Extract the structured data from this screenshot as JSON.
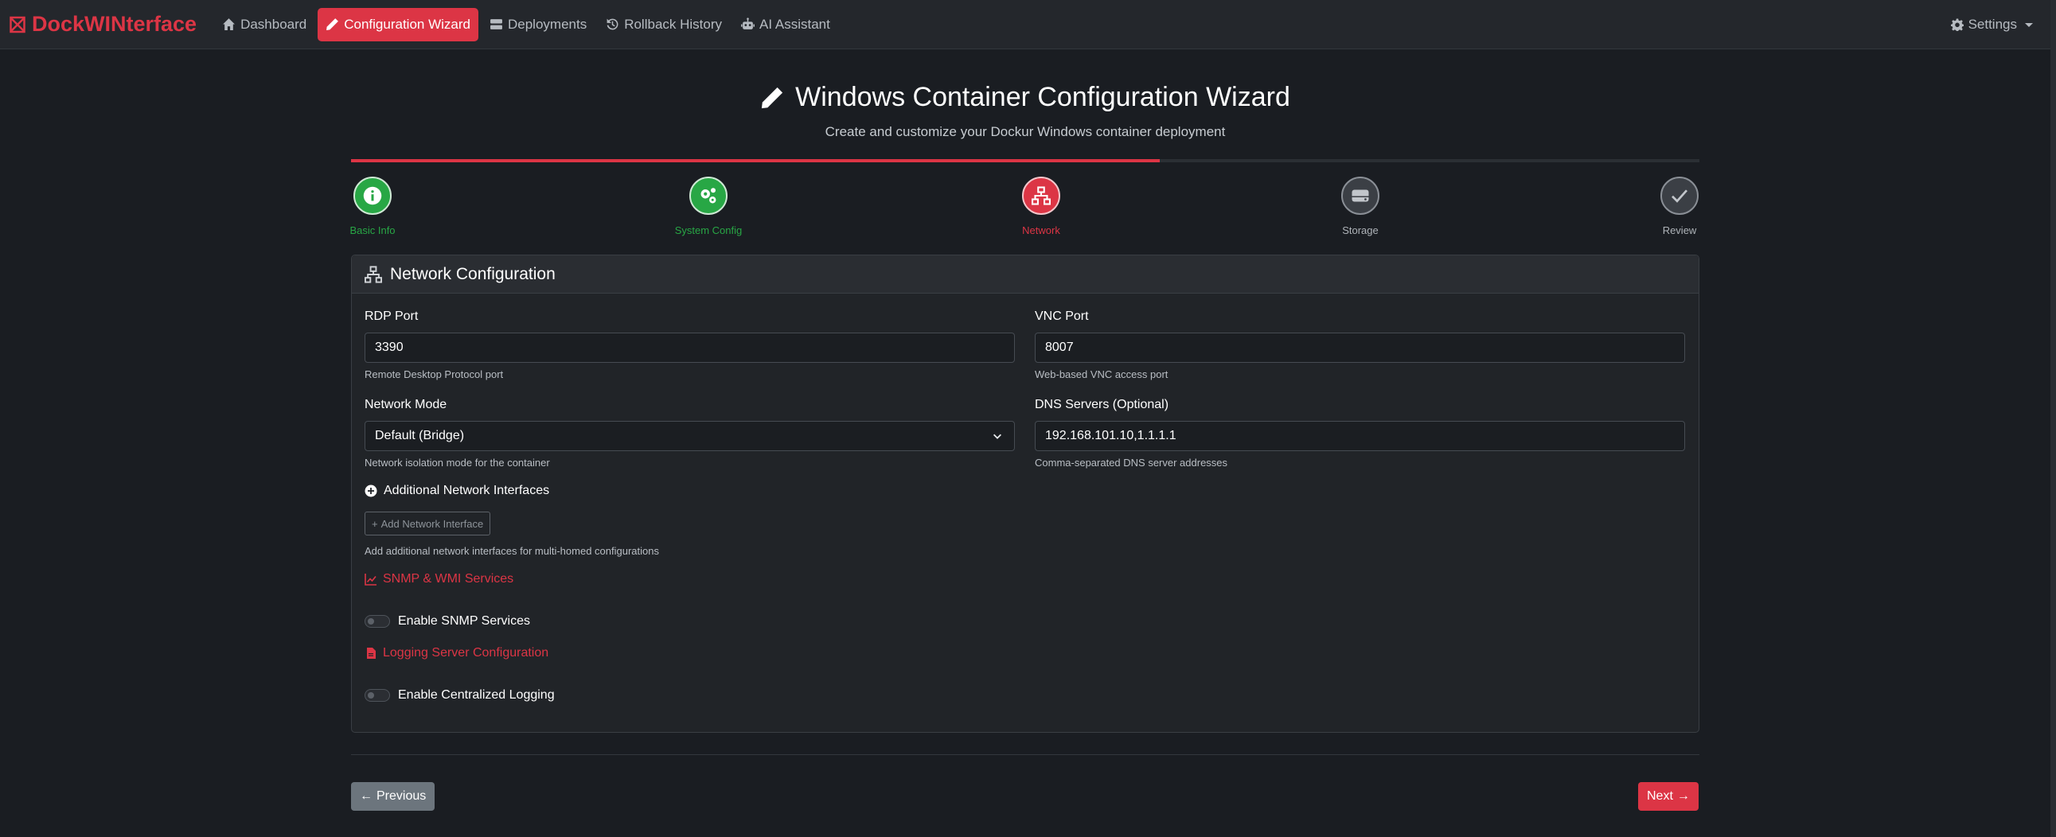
{
  "nav": {
    "brand": "DockWINterface",
    "links": [
      {
        "label": "Dashboard",
        "icon": "home-icon",
        "active": false
      },
      {
        "label": "Configuration Wizard",
        "icon": "pencil-icon",
        "active": true
      },
      {
        "label": "Deployments",
        "icon": "server-icon",
        "active": false
      },
      {
        "label": "Rollback History",
        "icon": "history-icon",
        "active": false
      },
      {
        "label": "AI Assistant",
        "icon": "robot-icon",
        "active": false
      }
    ],
    "settings": "Settings"
  },
  "header": {
    "title": "Windows Container Configuration Wizard",
    "subtitle": "Create and customize your Dockur Windows container deployment"
  },
  "wizard": {
    "progress": 0.6,
    "steps": [
      {
        "label": "Basic Info",
        "state": "done",
        "icon": "info-icon"
      },
      {
        "label": "System Config",
        "state": "done",
        "icon": "gears-icon"
      },
      {
        "label": "Network",
        "state": "current",
        "icon": "network-icon"
      },
      {
        "label": "Storage",
        "state": "todo",
        "icon": "hdd-icon"
      },
      {
        "label": "Review",
        "state": "todo",
        "icon": "check-icon"
      }
    ]
  },
  "card": {
    "title": "Network Configuration",
    "rdp": {
      "label": "RDP Port",
      "value": "3390",
      "help": "Remote Desktop Protocol port"
    },
    "vnc": {
      "label": "VNC Port",
      "value": "8007",
      "help": "Web-based VNC access port"
    },
    "network_mode": {
      "label": "Network Mode",
      "value": "Default (Bridge)",
      "help": "Network isolation mode for the container"
    },
    "dns": {
      "label": "DNS Servers (Optional)",
      "value": "192.168.101.10,1.1.1.1",
      "help": "Comma-separated DNS server addresses"
    },
    "additional": {
      "title": "Additional Network Interfaces",
      "button": "Add Network Interface",
      "help": "Add additional network interfaces for multi-homed configurations"
    },
    "snmp": {
      "title": "SNMP & WMI Services",
      "toggle": "Enable SNMP Services",
      "enabled": false
    },
    "logging": {
      "title": "Logging Server Configuration",
      "toggle": "Enable Centralized Logging",
      "enabled": false
    }
  },
  "footer": {
    "previous": "Previous",
    "next": "Next"
  },
  "colors": {
    "accent": "#dc3545",
    "success": "#28a745",
    "background": "#1a1d22"
  }
}
